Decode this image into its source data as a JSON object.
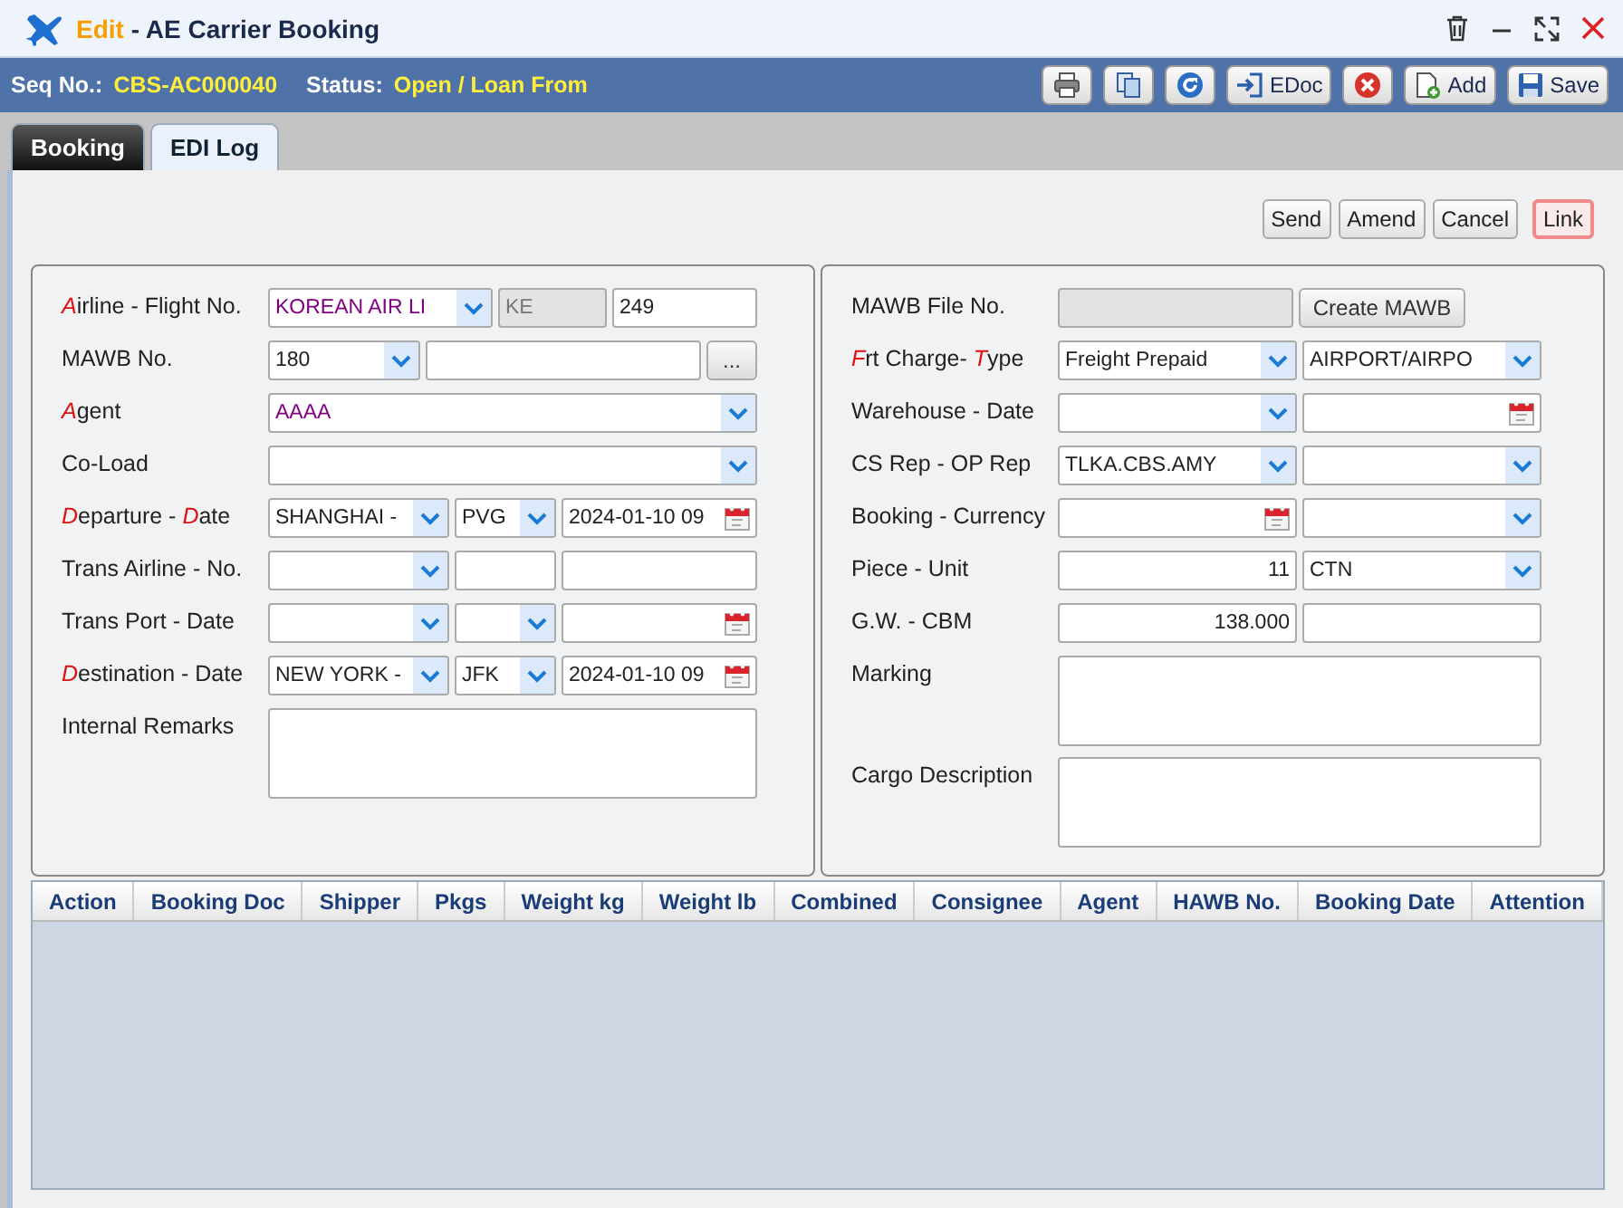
{
  "window": {
    "mode": "Edit",
    "separator": "-",
    "title": "AE Carrier Booking"
  },
  "toolbar": {
    "seq_label": "Seq No.:",
    "seq_value": "CBS-AC000040",
    "status_label": "Status:",
    "status_value": "Open / Loan From",
    "buttons": [
      {
        "kind": "print"
      },
      {
        "kind": "copy"
      },
      {
        "kind": "refresh"
      },
      {
        "kind": "edoc",
        "label": "EDoc"
      },
      {
        "kind": "delete"
      },
      {
        "kind": "add",
        "label": "Add"
      },
      {
        "kind": "save",
        "label": "Save"
      }
    ]
  },
  "tabs": [
    {
      "label": "Booking",
      "selected": true
    },
    {
      "label": "EDI Log",
      "selected": false
    }
  ],
  "actions": [
    {
      "label": "Send",
      "focused": false
    },
    {
      "label": "Amend",
      "focused": false
    },
    {
      "label": "Cancel",
      "focused": false
    },
    {
      "label": "Link",
      "focused": true
    }
  ],
  "left_form": [
    {
      "label": [
        {
          "text": "A",
          "required": true
        },
        {
          "text": "irline -  Flight No.",
          "required": false
        }
      ],
      "fields": [
        {
          "kind": "select",
          "value": "KOREAN AIR LI",
          "highlight": true
        },
        {
          "kind": "readonly",
          "value": "KE"
        },
        {
          "kind": "input",
          "value": "249",
          "highlight": false
        }
      ]
    },
    {
      "label": [
        {
          "text": "MAWB No.",
          "required": false
        }
      ],
      "fields": [
        {
          "kind": "select",
          "value": "180",
          "highlight": false
        },
        {
          "kind": "input"
        },
        {
          "kind": "button",
          "value": "..."
        }
      ]
    },
    {
      "label": [
        {
          "text": "A",
          "required": true
        },
        {
          "text": "gent",
          "required": false
        }
      ],
      "fields": [
        {
          "kind": "select",
          "value": "AAAA",
          "highlight": true
        }
      ]
    },
    {
      "label": [
        {
          "text": "Co-Load",
          "required": false
        }
      ],
      "fields": [
        {
          "kind": "select"
        }
      ]
    },
    {
      "label": [
        {
          "text": "D",
          "required": true
        },
        {
          "text": "eparture -  ",
          "required": false
        },
        {
          "text": "D",
          "required": true
        },
        {
          "text": "ate",
          "required": false
        }
      ],
      "fields": [
        {
          "kind": "select",
          "value": "SHANGHAI -",
          "highlight": false
        },
        {
          "kind": "select",
          "value": "PVG",
          "highlight": false
        },
        {
          "kind": "date",
          "value": "2024-01-10 09",
          "highlight": false
        }
      ]
    },
    {
      "label": [
        {
          "text": "Trans Airline -  No.",
          "required": false
        }
      ],
      "fields": [
        {
          "kind": "select"
        },
        {
          "kind": "input"
        },
        {
          "kind": "input"
        }
      ]
    },
    {
      "label": [
        {
          "text": "Trans Port -  Date",
          "required": false
        }
      ],
      "fields": [
        {
          "kind": "select"
        },
        {
          "kind": "select"
        },
        {
          "kind": "date"
        }
      ]
    },
    {
      "label": [
        {
          "text": "D",
          "required": true
        },
        {
          "text": "estination -  Date",
          "required": false
        }
      ],
      "fields": [
        {
          "kind": "select",
          "value": "NEW YORK -",
          "highlight": false
        },
        {
          "kind": "select",
          "value": "JFK",
          "highlight": false
        },
        {
          "kind": "date",
          "value": "2024-01-10 09",
          "highlight": false
        }
      ]
    },
    {
      "label": [
        {
          "text": "Internal Remarks",
          "required": false
        }
      ],
      "fields": [
        {
          "kind": "textarea"
        }
      ]
    }
  ],
  "right_form": [
    {
      "label": [
        {
          "text": "MAWB File No.",
          "required": false
        }
      ],
      "fields": [
        {
          "kind": "readonly"
        },
        {
          "kind": "button",
          "value": "Create MAWB"
        }
      ]
    },
    {
      "label": [
        {
          "text": "F",
          "required": true
        },
        {
          "text": "rt Charge- ",
          "required": false
        },
        {
          "text": "T",
          "required": true
        },
        {
          "text": "ype",
          "required": false
        }
      ],
      "fields": [
        {
          "kind": "select",
          "value": "Freight Prepaid",
          "highlight": false
        },
        {
          "kind": "select",
          "value": "AIRPORT/AIRPO",
          "highlight": false
        }
      ]
    },
    {
      "label": [
        {
          "text": "Warehouse -  Date",
          "required": false
        }
      ],
      "fields": [
        {
          "kind": "select"
        },
        {
          "kind": "date"
        }
      ]
    },
    {
      "label": [
        {
          "text": "CS Rep -  OP Rep",
          "required": false
        }
      ],
      "fields": [
        {
          "kind": "select",
          "value": "TLKA.CBS.AMY",
          "highlight": false
        },
        {
          "kind": "select"
        }
      ]
    },
    {
      "label": [
        {
          "text": "Booking -  Currency",
          "required": false
        }
      ],
      "fields": [
        {
          "kind": "date"
        },
        {
          "kind": "select"
        }
      ]
    },
    {
      "label": [
        {
          "text": "Piece -  Unit",
          "required": false
        }
      ],
      "fields": [
        {
          "kind": "number",
          "value": "11",
          "highlight": false
        },
        {
          "kind": "select",
          "value": "CTN",
          "highlight": false
        }
      ]
    },
    {
      "label": [
        {
          "text": "G.W. -  CBM",
          "required": false
        }
      ],
      "fields": [
        {
          "kind": "number",
          "value": "138.000",
          "highlight": false
        },
        {
          "kind": "input"
        }
      ]
    },
    {
      "label": [
        {
          "text": "Marking",
          "required": false
        }
      ],
      "fields": [
        {
          "kind": "textarea"
        }
      ]
    },
    {
      "label": [
        {
          "text": "Cargo Description",
          "required": false
        }
      ],
      "fields": [
        {
          "kind": "textarea"
        }
      ]
    }
  ],
  "table": {
    "columns": [
      "Action",
      "Booking Doc",
      "Shipper",
      "Pkgs",
      "Weight kg",
      "Weight lb",
      "Combined",
      "Consignee",
      "Agent",
      "HAWB No.",
      "Booking Date",
      "Attention"
    ]
  }
}
